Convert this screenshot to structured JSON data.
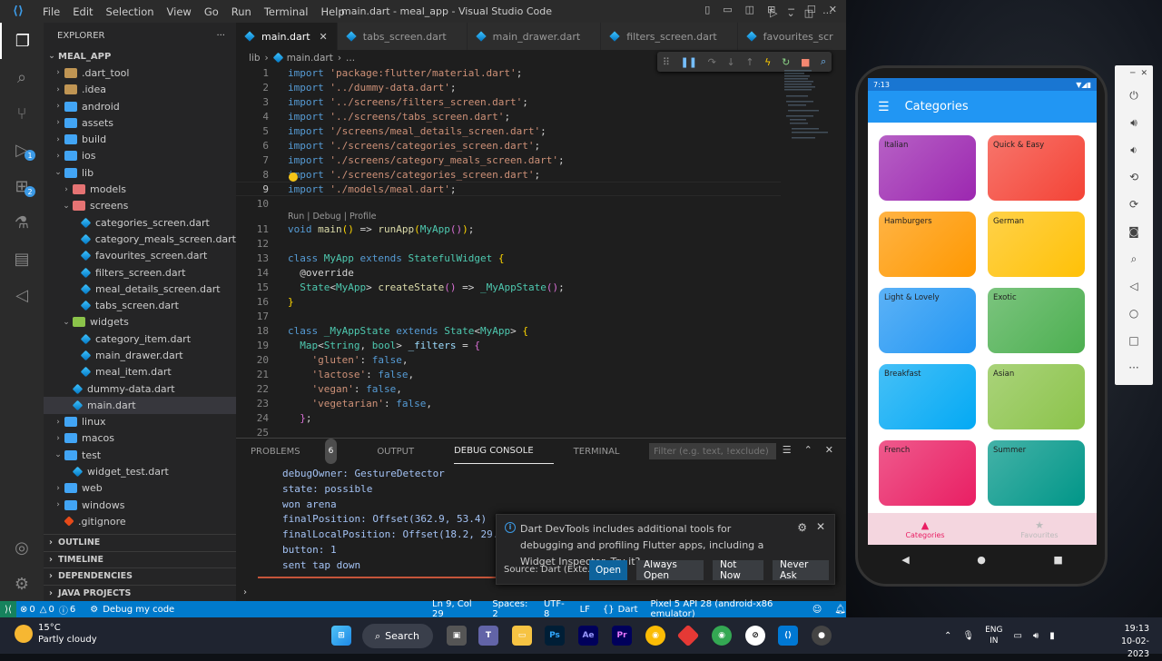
{
  "titlebar": {
    "menu": [
      "File",
      "Edit",
      "Selection",
      "View",
      "Go",
      "Run",
      "Terminal",
      "Help"
    ],
    "window_title": "main.dart - meal_app - Visual Studio Code"
  },
  "activity": {
    "scm_badge": "1",
    "ext_badge": "2"
  },
  "explorer": {
    "header": "EXPLORER",
    "root": "MEAL_APP",
    "items": [
      {
        "label": ".dart_tool",
        "depth": 1,
        "type": "folder"
      },
      {
        "label": ".idea",
        "depth": 1,
        "type": "folder"
      },
      {
        "label": "android",
        "depth": 1,
        "type": "folder"
      },
      {
        "label": "assets",
        "depth": 1,
        "type": "folder"
      },
      {
        "label": "build",
        "depth": 1,
        "type": "folder"
      },
      {
        "label": "ios",
        "depth": 1,
        "type": "folder"
      },
      {
        "label": "lib",
        "depth": 1,
        "type": "folder-open"
      },
      {
        "label": "models",
        "depth": 2,
        "type": "folder"
      },
      {
        "label": "screens",
        "depth": 2,
        "type": "folder-open"
      },
      {
        "label": "categories_screen.dart",
        "depth": 3,
        "type": "dart"
      },
      {
        "label": "category_meals_screen.dart",
        "depth": 3,
        "type": "dart"
      },
      {
        "label": "favourites_screen.dart",
        "depth": 3,
        "type": "dart"
      },
      {
        "label": "filters_screen.dart",
        "depth": 3,
        "type": "dart"
      },
      {
        "label": "meal_details_screen.dart",
        "depth": 3,
        "type": "dart"
      },
      {
        "label": "tabs_screen.dart",
        "depth": 3,
        "type": "dart"
      },
      {
        "label": "widgets",
        "depth": 2,
        "type": "folder-open"
      },
      {
        "label": "category_item.dart",
        "depth": 3,
        "type": "dart"
      },
      {
        "label": "main_drawer.dart",
        "depth": 3,
        "type": "dart"
      },
      {
        "label": "meal_item.dart",
        "depth": 3,
        "type": "dart"
      },
      {
        "label": "dummy-data.dart",
        "depth": 2,
        "type": "dart"
      },
      {
        "label": "main.dart",
        "depth": 2,
        "type": "dart",
        "selected": true
      },
      {
        "label": "linux",
        "depth": 1,
        "type": "folder"
      },
      {
        "label": "macos",
        "depth": 1,
        "type": "folder"
      },
      {
        "label": "test",
        "depth": 1,
        "type": "folder-open"
      },
      {
        "label": "widget_test.dart",
        "depth": 2,
        "type": "dart"
      },
      {
        "label": "web",
        "depth": 1,
        "type": "folder"
      },
      {
        "label": "windows",
        "depth": 1,
        "type": "folder"
      },
      {
        "label": ".gitignore",
        "depth": 1,
        "type": "git"
      }
    ],
    "bottom_sections": [
      "OUTLINE",
      "TIMELINE",
      "DEPENDENCIES",
      "JAVA PROJECTS"
    ]
  },
  "tabs": [
    {
      "label": "main.dart",
      "active": true
    },
    {
      "label": "tabs_screen.dart",
      "active": false
    },
    {
      "label": "main_drawer.dart",
      "active": false
    },
    {
      "label": "filters_screen.dart",
      "active": false
    },
    {
      "label": "favourites_scr",
      "active": false
    }
  ],
  "breadcrumb": {
    "folder": "lib",
    "file": "main.dart",
    "more": "..."
  },
  "editor": {
    "codelens": "Run | Debug | Profile",
    "current_line": 9
  },
  "panel": {
    "tabs": [
      "PROBLEMS",
      "OUTPUT",
      "DEBUG CONSOLE",
      "TERMINAL"
    ],
    "problems_count": "6",
    "active_tab": "DEBUG CONSOLE",
    "filter_placeholder": "Filter (e.g. text, !exclude)",
    "console": [
      "debugOwner: GestureDetector",
      "state: possible",
      "won arena",
      "finalPosition: Offset(362.9, 53.4)",
      "finalLocalPosition: Offset(18.2, 29.4)",
      "button: 1",
      "sent tap down"
    ]
  },
  "notification": {
    "message": "Dart DevTools includes additional tools for debugging and profiling Flutter apps, including a Widget Inspector. Try it?",
    "source": "Source: Dart (Exte...",
    "buttons": [
      "Open",
      "Always Open",
      "Not Now",
      "Never Ask"
    ]
  },
  "statusbar": {
    "errors": "0",
    "warnings": "0",
    "infos": "6",
    "debug": "Debug my code",
    "position": "Ln 9, Col 29",
    "spaces": "Spaces: 2",
    "encoding": "UTF-8",
    "eol": "LF",
    "language": "Dart",
    "device": "Pixel 5 API 28 (android-x86 emulator)"
  },
  "phone": {
    "time": "7:13",
    "title": "Categories",
    "categories": [
      {
        "name": "Italian",
        "color": "#9c27b0"
      },
      {
        "name": "Quick & Easy",
        "color": "#f44336"
      },
      {
        "name": "Hamburgers",
        "color": "#ff9800"
      },
      {
        "name": "German",
        "color": "#ffc107"
      },
      {
        "name": "Light & Lovely",
        "color": "#2196f3"
      },
      {
        "name": "Exotic",
        "color": "#4caf50"
      },
      {
        "name": "Breakfast",
        "color": "#03a9f4"
      },
      {
        "name": "Asian",
        "color": "#8bc34a"
      },
      {
        "name": "French",
        "color": "#e91e63"
      },
      {
        "name": "Summer",
        "color": "#009688"
      }
    ],
    "nav": [
      {
        "label": "Categories",
        "active": true
      },
      {
        "label": "Favourites",
        "active": false
      }
    ]
  },
  "taskbar": {
    "temp": "15°C",
    "weather": "Partly cloudy",
    "search": "Search",
    "lang1": "ENG",
    "lang2": "IN",
    "time": "19:13",
    "date": "10-02-2023"
  }
}
